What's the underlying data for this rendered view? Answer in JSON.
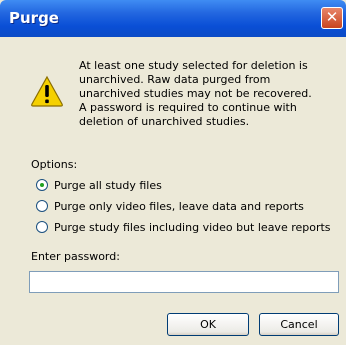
{
  "window": {
    "title": "Purge",
    "close_glyph": "✕"
  },
  "message": {
    "icon": "warning-icon",
    "lines": [
      "At least one study selected for deletion is",
      "unarchived. Raw data purged from",
      "unarchived studies may not be recovered.",
      "A password is required to continue with",
      "deletion of unarchived studies."
    ]
  },
  "options": {
    "label": "Options:",
    "selected_index": 0,
    "items": [
      "Purge all study files",
      "Purge only video files, leave data and reports",
      "Purge study files including video but leave reports"
    ]
  },
  "password": {
    "label": "Enter password:",
    "value": ""
  },
  "buttons": {
    "ok": "OK",
    "cancel": "Cancel"
  },
  "colors": {
    "titlebar": "#0b4bc6",
    "close": "#c8441e",
    "dialog_bg": "#ece9d8",
    "warning": "#f5d000"
  }
}
